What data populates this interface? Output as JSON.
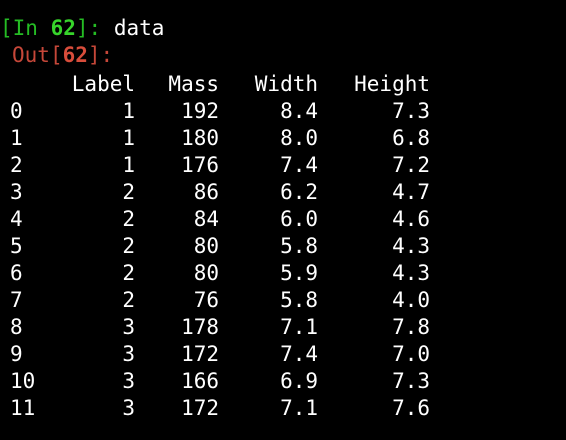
{
  "input_prompt": {
    "bracket_open": "[",
    "label": "In ",
    "number": "62",
    "bracket_close": "]: ",
    "code": "data"
  },
  "output_prompt": {
    "label": "Out",
    "bracket_open": "[",
    "number": "62",
    "bracket_close": "]:"
  },
  "table": {
    "columns": [
      "Label",
      "Mass",
      "Width",
      "Height"
    ],
    "rows": [
      {
        "index": "0",
        "Label": "1",
        "Mass": "192",
        "Width": "8.4",
        "Height": "7.3"
      },
      {
        "index": "1",
        "Label": "1",
        "Mass": "180",
        "Width": "8.0",
        "Height": "6.8"
      },
      {
        "index": "2",
        "Label": "1",
        "Mass": "176",
        "Width": "7.4",
        "Height": "7.2"
      },
      {
        "index": "3",
        "Label": "2",
        "Mass": "86",
        "Width": "6.2",
        "Height": "4.7"
      },
      {
        "index": "4",
        "Label": "2",
        "Mass": "84",
        "Width": "6.0",
        "Height": "4.6"
      },
      {
        "index": "5",
        "Label": "2",
        "Mass": "80",
        "Width": "5.8",
        "Height": "4.3"
      },
      {
        "index": "6",
        "Label": "2",
        "Mass": "80",
        "Width": "5.9",
        "Height": "4.3"
      },
      {
        "index": "7",
        "Label": "2",
        "Mass": "76",
        "Width": "5.8",
        "Height": "4.0"
      },
      {
        "index": "8",
        "Label": "3",
        "Mass": "178",
        "Width": "7.1",
        "Height": "7.8"
      },
      {
        "index": "9",
        "Label": "3",
        "Mass": "172",
        "Width": "7.4",
        "Height": "7.0"
      },
      {
        "index": "10",
        "Label": "3",
        "Mass": "166",
        "Width": "6.9",
        "Height": "7.3"
      },
      {
        "index": "11",
        "Label": "3",
        "Mass": "172",
        "Width": "7.1",
        "Height": "7.6"
      }
    ]
  },
  "colors": {
    "background": "#000000",
    "text": "#ffffff",
    "in_prompt": "#25bc24",
    "out_prompt": "#c64739"
  }
}
